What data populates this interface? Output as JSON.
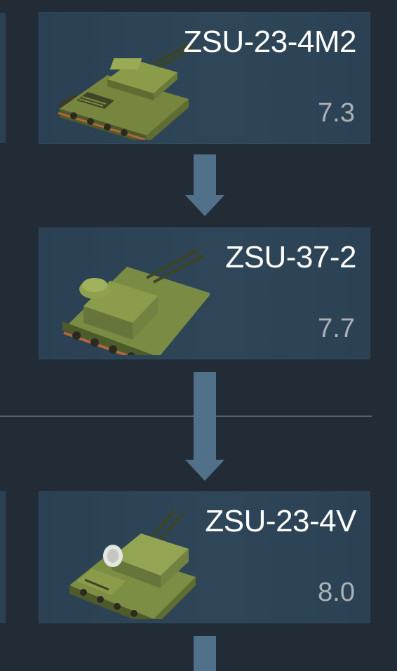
{
  "tree": {
    "items": [
      {
        "name": "ZSU-23-4M2",
        "br": "7.3",
        "vehicle_icon": "spaa-tank-icon"
      },
      {
        "name": "ZSU-37-2",
        "br": "7.7",
        "vehicle_icon": "spaa-tank-icon"
      },
      {
        "name": "ZSU-23-4V",
        "br": "8.0",
        "vehicle_icon": "spaa-tank-icon"
      }
    ]
  },
  "colors": {
    "background": "#222c36",
    "card": "#2d4456",
    "arrow": "#51708a",
    "name_text": "#ffffff",
    "br_text": "#aab1b7"
  }
}
